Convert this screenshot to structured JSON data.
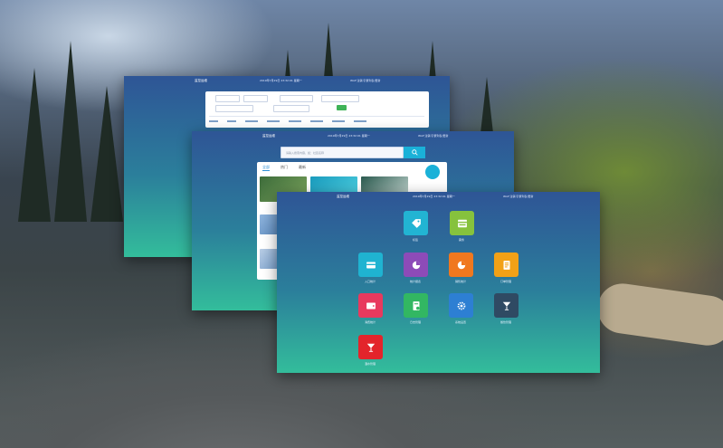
{
  "window_back": {
    "title": "监控运维",
    "datetime": "2019年7月29日 23:32:01 星期一",
    "user": "Wolf 注销 引擎列表/更新"
  },
  "window_middle": {
    "title": "监控运维",
    "datetime": "2019年7月29日 23:32:01 星期一",
    "user": "Wolf 注销 引擎列表/更新",
    "search_placeholder": "请输入搜索内容，如：社区名称",
    "tabs": [
      "全部",
      "热门",
      "最新"
    ],
    "active_tab": 0
  },
  "window_front": {
    "title": "监控运维",
    "datetime": "2019年7月29日 23:32:01 星期一",
    "user": "Wolf 注销 引擎列表/更新",
    "apps": [
      {
        "name": "标签",
        "icon": "tag-icon",
        "color": "#22b4d3"
      },
      {
        "name": "票务",
        "icon": "ticket-icon",
        "color": "#86c23d"
      },
      {
        "name": "入口统计",
        "icon": "card-icon",
        "color": "#1fb3d1"
      },
      {
        "name": "统计报表",
        "icon": "pie-chart-icon",
        "color": "#8d4bb8"
      },
      {
        "name": "销售统计",
        "icon": "pie-chart-icon",
        "color": "#f0781f"
      },
      {
        "name": "订单管理",
        "icon": "document-icon",
        "color": "#f2a117"
      },
      {
        "name": "消费统计",
        "icon": "wallet-icon",
        "color": "#e8395e"
      },
      {
        "name": "日志管理",
        "icon": "log-icon",
        "color": "#32b762"
      },
      {
        "name": "系统设置",
        "icon": "gear-icon",
        "color": "#2d7fd3"
      },
      {
        "name": "餐饮管理",
        "icon": "cocktail-icon",
        "color": "#2f4a63"
      },
      {
        "name": "酒水管理",
        "icon": "cocktail-icon",
        "color": "#e3242b"
      }
    ]
  }
}
